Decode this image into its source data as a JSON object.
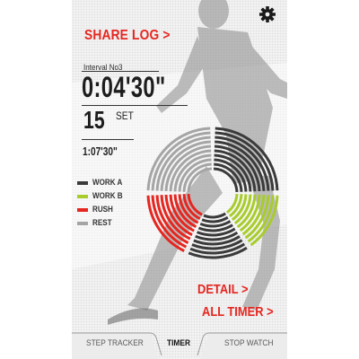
{
  "header": {
    "share_log_label": "SHARE LOG >",
    "settings_icon": "gear-icon"
  },
  "timer": {
    "interval_label": "Interval No3",
    "interval_time": "0:04'30\"",
    "set_count": "15",
    "set_label": "SET",
    "total_time": "1:07'30\""
  },
  "legend": [
    {
      "label": "WORK A",
      "color": "#3a3a3a"
    },
    {
      "label": "WORK B",
      "color": "#a8cc2c"
    },
    {
      "label": "RUSH",
      "color": "#e52620"
    },
    {
      "label": "REST",
      "color": "#a5a5a5"
    }
  ],
  "links": {
    "detail_label": "DETAIL >",
    "all_timer_label": "ALL TIMER >"
  },
  "tabs": [
    {
      "label": "STEP TRACKER",
      "active": false
    },
    {
      "label": "TIMER",
      "active": true
    },
    {
      "label": "STOP WATCH",
      "active": false
    }
  ]
}
